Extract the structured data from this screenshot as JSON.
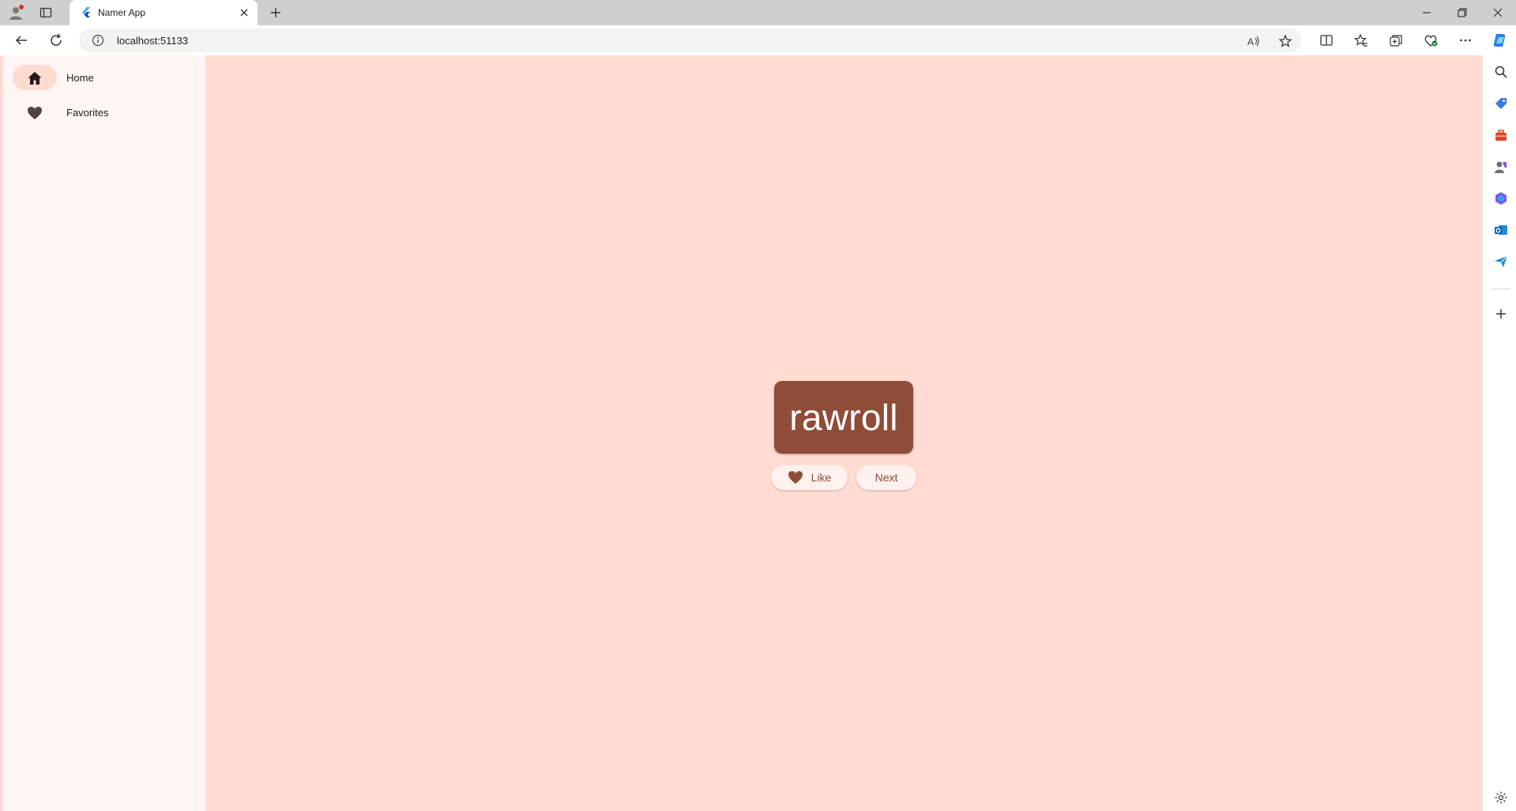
{
  "browser": {
    "tab_title": "Namer App",
    "url": "localhost:51133"
  },
  "app": {
    "nav": [
      {
        "label": "Home",
        "icon": "home-icon",
        "active": true
      },
      {
        "label": "Favorites",
        "icon": "heart-icon",
        "active": false
      }
    ],
    "current_pair": "rawroll",
    "like_label": "Like",
    "next_label": "Next"
  },
  "colors": {
    "background": "#ffdbd1",
    "rail": "#fff6f4",
    "primary": "#8f4c38",
    "button": "#fff1ed"
  }
}
